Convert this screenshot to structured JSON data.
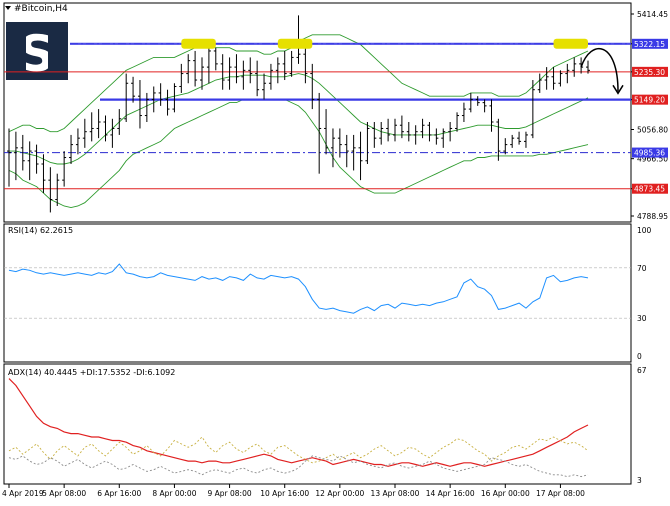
{
  "colors": {
    "background": "#ffffff",
    "frame": "#000000",
    "grid": "#c8c8c8",
    "price_candle": "#000000",
    "bollinger": "#2e9b2e",
    "blue_level": "#3a3ae6",
    "blue_dashdot": "#2a2ad0",
    "red_level": "#e02020",
    "highlight": "#e6e000",
    "rsi_line": "#1e90ff",
    "adx_line": "#e02020",
    "di_plus": "#c8b040",
    "di_minus": "#8c8c8c",
    "logo_bg": "#1a2a44",
    "label_red_bg": "#e02020",
    "label_blue_bg": "#3a3ae6"
  },
  "header": {
    "symbol_label": "#Bitcoin,H4",
    "dropdown_icon": "triangle-down-icon"
  },
  "chart_data": [
    {
      "type": "candlestick",
      "title": "#Bitcoin,H4",
      "ylim": [
        4788.95,
        5414.45
      ],
      "y_ticks": [
        "5414.45",
        "5322.15",
        "5235.30",
        "5149.20",
        "5056.80",
        "4966.50",
        "4873.45",
        "4788.95"
      ],
      "levels": [
        {
          "label": "5322.15",
          "value": 5322.15,
          "style": "blue-dashdot",
          "label_color": "#3a3ae6"
        },
        {
          "label": "5235.30",
          "value": 5235.3,
          "style": "red-solid",
          "label_color": "#e02020"
        },
        {
          "label": "5149.20",
          "value": 5149.2,
          "style": "blue-solid",
          "label_color": "#e02020"
        },
        {
          "label": "4985.36",
          "value": 4985.36,
          "style": "blue-dashdot",
          "label_color": "#3a3ae6"
        },
        {
          "label": "4873.45",
          "value": 4873.45,
          "style": "red-solid",
          "label_color": "#e02020"
        }
      ],
      "candles": [
        [
          4990,
          5060,
          4880,
          4985
        ],
        [
          4985,
          5050,
          4900,
          5000
        ],
        [
          5000,
          5040,
          4930,
          4960
        ],
        [
          4960,
          5020,
          4900,
          4990
        ],
        [
          4990,
          5010,
          4920,
          4950
        ],
        [
          4950,
          4980,
          4860,
          4900
        ],
        [
          4900,
          4940,
          4800,
          4840
        ],
        [
          4840,
          4920,
          4820,
          4900
        ],
        [
          4900,
          4990,
          4880,
          4970
        ],
        [
          4970,
          5040,
          4950,
          5010
        ],
        [
          5010,
          5060,
          4980,
          5030
        ],
        [
          5030,
          5090,
          5000,
          5050
        ],
        [
          5050,
          5110,
          5020,
          5060
        ],
        [
          5060,
          5120,
          5030,
          5080
        ],
        [
          5080,
          5100,
          5020,
          5040
        ],
        [
          5040,
          5090,
          5000,
          5060
        ],
        [
          5060,
          5120,
          5040,
          5090
        ],
        [
          5090,
          5230,
          5080,
          5200
        ],
        [
          5200,
          5220,
          5140,
          5160
        ],
        [
          5160,
          5210,
          5060,
          5100
        ],
        [
          5100,
          5170,
          5080,
          5150
        ],
        [
          5150,
          5190,
          5110,
          5170
        ],
        [
          5170,
          5200,
          5130,
          5150
        ],
        [
          5150,
          5180,
          5100,
          5120
        ],
        [
          5120,
          5200,
          5110,
          5190
        ],
        [
          5190,
          5260,
          5170,
          5230
        ],
        [
          5230,
          5290,
          5200,
          5270
        ],
        [
          5270,
          5300,
          5190,
          5210
        ],
        [
          5210,
          5280,
          5180,
          5250
        ],
        [
          5250,
          5320,
          5200,
          5300
        ],
        [
          5300,
          5310,
          5240,
          5260
        ],
        [
          5260,
          5290,
          5180,
          5210
        ],
        [
          5210,
          5280,
          5180,
          5250
        ],
        [
          5250,
          5290,
          5200,
          5220
        ],
        [
          5220,
          5270,
          5180,
          5240
        ],
        [
          5240,
          5280,
          5200,
          5230
        ],
        [
          5230,
          5270,
          5160,
          5180
        ],
        [
          5180,
          5230,
          5150,
          5200
        ],
        [
          5200,
          5260,
          5180,
          5240
        ],
        [
          5240,
          5280,
          5200,
          5260
        ],
        [
          5260,
          5300,
          5210,
          5230
        ],
        [
          5230,
          5300,
          5220,
          5280
        ],
        [
          5280,
          5410,
          5260,
          5290
        ],
        [
          5290,
          5310,
          5200,
          5230
        ],
        [
          5230,
          5260,
          5120,
          5150
        ],
        [
          5150,
          5170,
          4920,
          5060
        ],
        [
          5060,
          5120,
          4980,
          5000
        ],
        [
          5000,
          5060,
          4940,
          5030
        ],
        [
          5030,
          5060,
          4970,
          5010
        ],
        [
          5010,
          5040,
          4940,
          4990
        ],
        [
          4990,
          5040,
          4930,
          5000
        ],
        [
          5000,
          5050,
          4900,
          4960
        ],
        [
          4960,
          5080,
          4950,
          5060
        ],
        [
          5060,
          5080,
          5000,
          5030
        ],
        [
          5030,
          5080,
          5010,
          5060
        ],
        [
          5060,
          5090,
          5020,
          5040
        ],
        [
          5040,
          5090,
          5020,
          5070
        ],
        [
          5070,
          5100,
          5030,
          5050
        ],
        [
          5050,
          5080,
          5020,
          5040
        ],
        [
          5040,
          5070,
          5010,
          5050
        ],
        [
          5050,
          5090,
          5030,
          5070
        ],
        [
          5070,
          5080,
          5020,
          5040
        ],
        [
          5040,
          5060,
          5010,
          5030
        ],
        [
          5030,
          5060,
          5000,
          5050
        ],
        [
          5050,
          5080,
          5020,
          5060
        ],
        [
          5060,
          5110,
          5050,
          5100
        ],
        [
          5100,
          5140,
          5080,
          5120
        ],
        [
          5120,
          5170,
          5110,
          5150
        ],
        [
          5150,
          5160,
          5130,
          5140
        ],
        [
          5140,
          5150,
          5110,
          5130
        ],
        [
          5130,
          5150,
          5050,
          5080
        ],
        [
          5080,
          5090,
          4960,
          4990
        ],
        [
          4990,
          5030,
          4980,
          5010
        ],
        [
          5010,
          5040,
          5000,
          5030
        ],
        [
          5030,
          5050,
          5010,
          5020
        ],
        [
          5020,
          5050,
          5000,
          5040
        ],
        [
          5040,
          5210,
          5030,
          5180
        ],
        [
          5180,
          5230,
          5170,
          5210
        ],
        [
          5210,
          5250,
          5180,
          5220
        ],
        [
          5220,
          5250,
          5180,
          5200
        ],
        [
          5200,
          5240,
          5190,
          5230
        ],
        [
          5230,
          5260,
          5200,
          5240
        ],
        [
          5240,
          5280,
          5220,
          5260
        ],
        [
          5260,
          5280,
          5230,
          5250
        ],
        [
          5250,
          5270,
          5230,
          5240
        ]
      ],
      "bollinger": {
        "upper": [
          5050,
          5060,
          5070,
          5070,
          5060,
          5060,
          5050,
          5050,
          5060,
          5080,
          5100,
          5120,
          5140,
          5160,
          5180,
          5200,
          5220,
          5240,
          5250,
          5260,
          5270,
          5280,
          5280,
          5280,
          5280,
          5290,
          5300,
          5310,
          5310,
          5310,
          5310,
          5310,
          5310,
          5300,
          5300,
          5300,
          5300,
          5290,
          5290,
          5300,
          5300,
          5310,
          5330,
          5340,
          5350,
          5350,
          5350,
          5350,
          5350,
          5340,
          5330,
          5320,
          5300,
          5280,
          5260,
          5240,
          5220,
          5200,
          5190,
          5180,
          5170,
          5160,
          5160,
          5160,
          5160,
          5160,
          5160,
          5170,
          5170,
          5170,
          5170,
          5160,
          5160,
          5160,
          5160,
          5170,
          5190,
          5210,
          5230,
          5250,
          5260,
          5270,
          5280,
          5290,
          5300
        ],
        "middle": [
          4990,
          4990,
          4985,
          4980,
          4975,
          4965,
          4955,
          4950,
          4950,
          4955,
          4965,
          4980,
          5000,
          5020,
          5040,
          5060,
          5080,
          5100,
          5110,
          5120,
          5130,
          5140,
          5150,
          5155,
          5160,
          5165,
          5170,
          5180,
          5190,
          5200,
          5210,
          5215,
          5220,
          5220,
          5225,
          5225,
          5225,
          5225,
          5220,
          5220,
          5220,
          5225,
          5230,
          5225,
          5215,
          5200,
          5180,
          5160,
          5140,
          5120,
          5100,
          5080,
          5070,
          5060,
          5050,
          5045,
          5040,
          5040,
          5040,
          5040,
          5040,
          5040,
          5040,
          5045,
          5050,
          5055,
          5060,
          5065,
          5070,
          5070,
          5070,
          5065,
          5060,
          5060,
          5060,
          5065,
          5075,
          5085,
          5095,
          5105,
          5115,
          5125,
          5135,
          5145,
          5155
        ],
        "lower": [
          4930,
          4920,
          4900,
          4890,
          4880,
          4860,
          4840,
          4830,
          4820,
          4815,
          4820,
          4830,
          4850,
          4870,
          4890,
          4910,
          4930,
          4960,
          4980,
          4990,
          5000,
          5010,
          5020,
          5040,
          5060,
          5070,
          5080,
          5090,
          5100,
          5110,
          5120,
          5130,
          5140,
          5140,
          5150,
          5150,
          5150,
          5150,
          5150,
          5150,
          5150,
          5140,
          5130,
          5110,
          5080,
          5050,
          5010,
          4970,
          4940,
          4920,
          4900,
          4880,
          4870,
          4860,
          4860,
          4860,
          4860,
          4870,
          4880,
          4890,
          4900,
          4910,
          4920,
          4930,
          4940,
          4950,
          4960,
          4960,
          4970,
          4970,
          4975,
          4975,
          4975,
          4975,
          4975,
          4975,
          4975,
          4980,
          4980,
          4985,
          4990,
          4995,
          5000,
          5005,
          5010
        ]
      },
      "annotations": [
        "highlight-box",
        "highlight-box",
        "highlight-box",
        "curved-arrow-down"
      ]
    },
    {
      "type": "line",
      "title": "RSI(14) 62.2615",
      "ylim": [
        0,
        100
      ],
      "y_ticks": [
        "100",
        "70",
        "30",
        "0"
      ],
      "levels": [
        70,
        30
      ],
      "series": [
        {
          "name": "RSI(14)",
          "values": [
            68,
            67,
            69,
            68,
            66,
            65,
            66,
            65,
            64,
            65,
            66,
            65,
            64,
            66,
            65,
            67,
            73,
            66,
            65,
            63,
            62,
            63,
            66,
            64,
            63,
            62,
            61,
            60,
            63,
            61,
            62,
            60,
            63,
            62,
            60,
            65,
            62,
            61,
            64,
            63,
            62,
            63,
            61,
            55,
            45,
            38,
            37,
            38,
            36,
            35,
            34,
            37,
            39,
            36,
            40,
            41,
            38,
            42,
            41,
            40,
            41,
            40,
            42,
            43,
            45,
            47,
            58,
            61,
            55,
            53,
            48,
            37,
            38,
            40,
            42,
            38,
            43,
            46,
            62,
            64,
            59,
            60,
            62,
            63,
            62
          ]
        }
      ]
    },
    {
      "type": "line",
      "title": "ADX(14) 40.4445 +DI:17.5352 -DI:6.1092",
      "ylim": [
        3,
        67
      ],
      "y_ticks": [
        "67",
        "3"
      ],
      "series": [
        {
          "name": "ADX(14)",
          "values": [
            62,
            58,
            52,
            46,
            40,
            36,
            34,
            33,
            31,
            30,
            30,
            29,
            28,
            28,
            27,
            26,
            26,
            25,
            23,
            22,
            20,
            19,
            18,
            17,
            16,
            15,
            14,
            14,
            13,
            14,
            14,
            13,
            13,
            14,
            15,
            16,
            17,
            18,
            17,
            15,
            14,
            13,
            14,
            15,
            16,
            15,
            14,
            12,
            13,
            14,
            15,
            14,
            13,
            12,
            12,
            11,
            12,
            13,
            13,
            12,
            11,
            12,
            13,
            12,
            11,
            12,
            13,
            13,
            12,
            11,
            12,
            13,
            14,
            15,
            16,
            17,
            18,
            20,
            22,
            24,
            26,
            28,
            31,
            33,
            35
          ]
        },
        {
          "name": "+DI",
          "values": [
            20,
            22,
            18,
            21,
            24,
            19,
            15,
            20,
            23,
            20,
            17,
            22,
            24,
            20,
            17,
            21,
            25,
            22,
            18,
            20,
            23,
            19,
            17,
            21,
            26,
            24,
            22,
            24,
            28,
            22,
            19,
            23,
            25,
            21,
            19,
            22,
            24,
            20,
            18,
            22,
            23,
            20,
            17,
            15,
            13,
            14,
            16,
            18,
            15,
            17,
            19,
            16,
            18,
            21,
            23,
            20,
            17,
            19,
            22,
            21,
            18,
            16,
            19,
            22,
            24,
            27,
            26,
            23,
            20,
            18,
            14,
            17,
            19,
            22,
            23,
            21,
            24,
            27,
            26,
            28,
            26,
            24,
            25,
            23,
            20
          ]
        },
        {
          "name": "-DI",
          "values": [
            16,
            15,
            17,
            14,
            12,
            13,
            16,
            14,
            11,
            13,
            15,
            12,
            10,
            12,
            14,
            12,
            9,
            10,
            12,
            10,
            8,
            9,
            11,
            9,
            7,
            8,
            9,
            8,
            6,
            8,
            9,
            8,
            7,
            9,
            10,
            8,
            7,
            9,
            10,
            8,
            7,
            8,
            10,
            14,
            17,
            16,
            15,
            14,
            17,
            15,
            13,
            14,
            12,
            11,
            10,
            12,
            13,
            11,
            10,
            11,
            12,
            14,
            12,
            10,
            9,
            8,
            9,
            10,
            11,
            12,
            16,
            15,
            14,
            12,
            11,
            12,
            10,
            8,
            7,
            6,
            6,
            5,
            6,
            5,
            6
          ]
        }
      ]
    }
  ],
  "x_axis": {
    "tick_labels": [
      "4 Apr 2019",
      "5 Apr 08:00",
      "6 Apr 16:00",
      "8 Apr 00:00",
      "9 Apr 08:00",
      "10 Apr 16:00",
      "12 Apr 00:00",
      "13 Apr 08:00",
      "14 Apr 16:00",
      "16 Apr 00:00",
      "17 Apr 08:00"
    ],
    "tick_indices": [
      0,
      8,
      16,
      24,
      32,
      40,
      48,
      56,
      64,
      72,
      80
    ]
  }
}
